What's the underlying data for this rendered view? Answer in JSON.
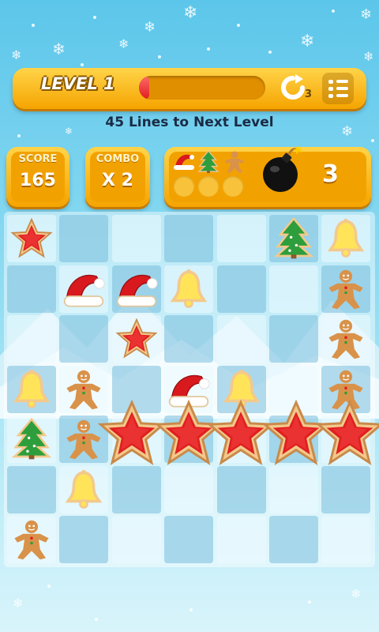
{
  "hud": {
    "level_label": "LEVEL 1",
    "level_progress": 0.08,
    "refresh_count": "3",
    "lines_text": "45 Lines to Next Level"
  },
  "stats": {
    "score_title": "SCORE",
    "score_value": "165",
    "combo_title": "COMBO",
    "combo_value": "X 2",
    "bomb_count": "3",
    "goal_icons": [
      "santa-hat-icon",
      "christmas-tree-icon",
      "gingerbread-man-icon"
    ]
  },
  "board": {
    "rows": 7,
    "cols": 7,
    "pieces": [
      [
        "star",
        "",
        "",
        "",
        "",
        "tree",
        "bell"
      ],
      [
        "",
        "hat",
        "hat",
        "bell",
        "",
        "",
        "gingerbread"
      ],
      [
        "",
        "",
        "star",
        "",
        "",
        "",
        "gingerbread"
      ],
      [
        "bell",
        "gingerbread",
        "",
        "hat",
        "bell",
        "",
        "gingerbread"
      ],
      [
        "tree",
        "gingerbread",
        "",
        "",
        "",
        "",
        ""
      ],
      [
        "",
        "bell",
        "",
        "",
        "",
        "",
        ""
      ],
      [
        "gingerbread",
        "",
        "",
        "",
        "",
        "",
        ""
      ]
    ],
    "large_star_row": "falling-star-row"
  },
  "colors": {
    "hud_gold": "#f5a400",
    "progress_red": "#e01d1d",
    "star_red": "#e02020",
    "cookie": "#f3c98b"
  }
}
